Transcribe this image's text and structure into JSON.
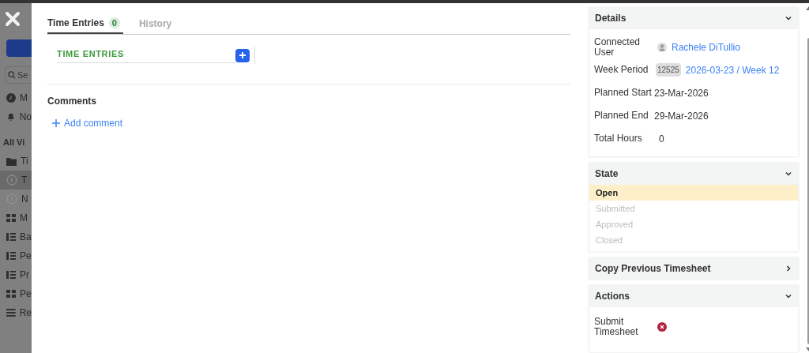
{
  "background_sidebar": {
    "search_placeholder": "Se",
    "items": [
      {
        "kind": "clock",
        "label": "M",
        "selected": false
      },
      {
        "kind": "bell",
        "label": "No",
        "selected": false
      },
      {
        "kind": "heading",
        "label": "All Vi"
      },
      {
        "kind": "folder",
        "label": "Ti",
        "selected": false
      },
      {
        "kind": "timer",
        "label": "T",
        "selected": true
      },
      {
        "kind": "timer",
        "label": "N",
        "selected": false
      },
      {
        "kind": "grid",
        "label": "M",
        "selected": false
      },
      {
        "kind": "bars",
        "label": "Ba",
        "selected": false
      },
      {
        "kind": "bars",
        "label": "Pe",
        "selected": false
      },
      {
        "kind": "bars",
        "label": "Pr",
        "selected": false
      },
      {
        "kind": "grid",
        "label": "Pe",
        "selected": false
      },
      {
        "kind": "list",
        "label": "Re",
        "selected": false
      }
    ]
  },
  "tabs": [
    {
      "label": "Time Entries",
      "badge": "0",
      "selected": true
    },
    {
      "label": "History",
      "selected": false
    }
  ],
  "time_entries": {
    "label": "TIME ENTRIES"
  },
  "comments": {
    "title": "Comments",
    "add_label": "Add comment"
  },
  "details": {
    "title": "Details",
    "expanded": true,
    "rows": [
      {
        "kind": "user",
        "label": "Connected User",
        "value": "Rachele DiTullio"
      },
      {
        "kind": "period",
        "label": "Week Period",
        "tag": "12525",
        "value": "2026-03-23 / Week 12"
      },
      {
        "kind": "text",
        "label": "Planned Start",
        "value": "23-Mar-2026"
      },
      {
        "kind": "text",
        "label": "Planned End",
        "value": "29-Mar-2026"
      },
      {
        "kind": "text",
        "label": "Total Hours",
        "value": "0"
      }
    ]
  },
  "state": {
    "title": "State",
    "expanded": true,
    "items": [
      {
        "label": "Open",
        "selected": true
      },
      {
        "label": "Submitted",
        "selected": false
      },
      {
        "label": "Approved",
        "selected": false
      },
      {
        "label": "Closed",
        "selected": false
      }
    ]
  },
  "copy_previous": {
    "title": "Copy Previous Timesheet",
    "expanded": false
  },
  "actions": {
    "title": "Actions",
    "expanded": true,
    "items": [
      {
        "label": "Submit Timesheet"
      }
    ]
  }
}
